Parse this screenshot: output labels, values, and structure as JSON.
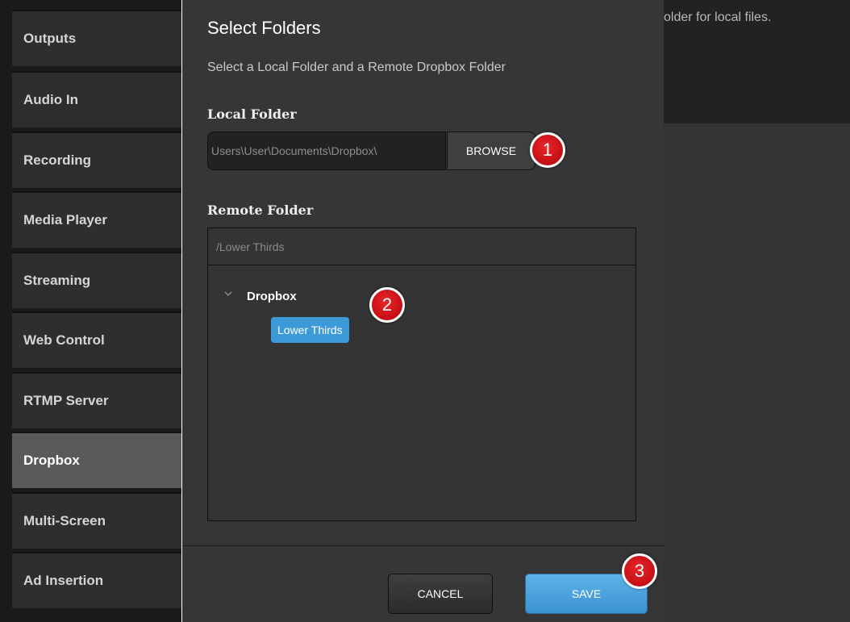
{
  "sidebar": {
    "items": [
      {
        "label": "Outputs"
      },
      {
        "label": "Audio In"
      },
      {
        "label": "Recording"
      },
      {
        "label": "Media Player"
      },
      {
        "label": "Streaming"
      },
      {
        "label": "Web Control"
      },
      {
        "label": "RTMP Server"
      },
      {
        "label": "Dropbox"
      },
      {
        "label": "Multi-Screen"
      },
      {
        "label": "Ad Insertion"
      }
    ],
    "active": "Dropbox"
  },
  "background": {
    "partial_text": "older for local files."
  },
  "dialog": {
    "title": "Select Folders",
    "subtitle": "Select a Local Folder and a Remote Dropbox Folder",
    "local_label": "Local Folder",
    "local_path": "Users\\User\\Documents\\Dropbox\\",
    "browse_label": "BROWSE",
    "remote_label": "Remote Folder",
    "remote_path": "/Lower Thirds",
    "tree": {
      "root": "Dropbox",
      "child": "Lower Thirds"
    },
    "cancel_label": "CANCEL",
    "save_label": "SAVE"
  },
  "markers": [
    "1",
    "2",
    "3"
  ],
  "colors": {
    "accent_blue": "#3d9ad9",
    "marker_red": "#d0161b",
    "dialog_bg": "#363636"
  }
}
